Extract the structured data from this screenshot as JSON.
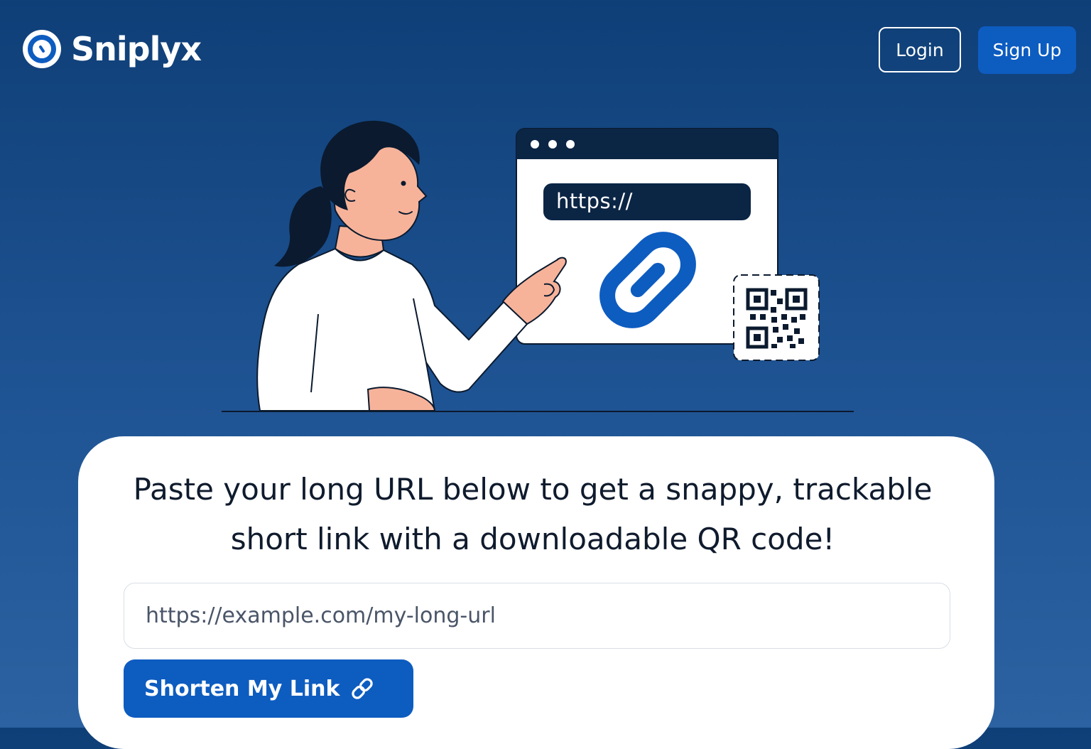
{
  "brand": {
    "name": "Sniplyx",
    "logo_icon": "sniplyx-logo-icon"
  },
  "header": {
    "login_label": "Login",
    "signup_label": "Sign Up"
  },
  "illustration": {
    "browser_url_text": "https://",
    "icons": [
      "woman-pointing-illustration",
      "link-icon",
      "qr-code-icon"
    ]
  },
  "main": {
    "headline_line1": "Paste your long URL below to get a snappy, trackable",
    "headline_line2": "short link with a downloadable QR code!",
    "input_placeholder": "https://example.com/my-long-url",
    "input_value": "",
    "submit_label": "Shorten My Link",
    "submit_icon": "chain-link-icon"
  },
  "colors": {
    "background_top": "#0f3f77",
    "background_bottom": "#2c62a1",
    "accent_blue": "#0d5cc0",
    "navy": "#0b2545",
    "card": "#ffffff",
    "text_dark": "#0f1b2d"
  }
}
